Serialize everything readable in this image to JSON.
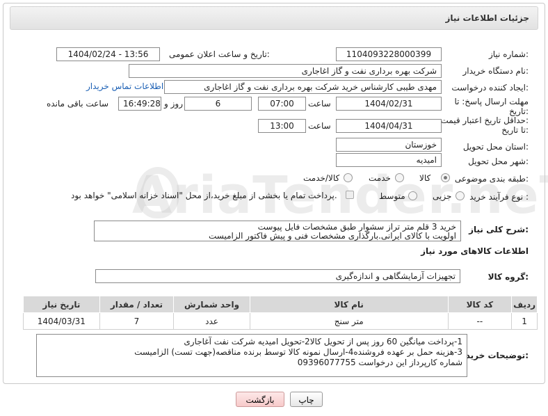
{
  "header": {
    "title": "جزئیات اطلاعات نیاز"
  },
  "form": {
    "need_number_label": "شماره نیاز:",
    "need_number": "1104093228000399",
    "announce_label": "تاریخ و ساعت اعلان عمومی:",
    "announce_value": "1404/02/24 - 13:56",
    "buyer_org_label": "نام دستگاه خریدار:",
    "buyer_org": "شرکت بهره برداری نفت و گاز اغاجاری",
    "creator_label": "ایجاد کننده درخواست:",
    "creator": "مهدی طیبی کارشناس خرید شرکت بهره برداری نفت و گاز اغاجاری",
    "contact_link": "اطلاعات تماس خریدار",
    "deadline_label": "مهلت ارسال پاسخ: تا",
    "deadline_label2": "تاریخ:",
    "deadline_date": "1404/02/31",
    "time_word": "ساعت",
    "deadline_time": "07:00",
    "days": "6",
    "days_word": "روز و",
    "remaining": "16:49:28",
    "remaining_word": "ساعت باقی مانده",
    "validity_label": "حداقل تاریخ اعتبار قیمت:",
    "validity_label2": "تا تاریخ:",
    "validity_date": "1404/04/31",
    "validity_time": "13:00",
    "province_label": "استان محل تحویل:",
    "province": "خوزستان",
    "city_label": "شهر محل تحویل:",
    "city": "امیدیه",
    "category_label": "طبقه بندی موضوعی:",
    "category_options": [
      "کالا",
      "خدمت",
      "کالا/خدمت"
    ],
    "process_label": "نوع فرآیند خرید :",
    "process_options": [
      "جزیی",
      "متوسط"
    ],
    "payment_note": "پرداخت تمام یا بخشی از مبلغ خرید،از محل \"اسناد خزانه اسلامی\" خواهد بود."
  },
  "description": {
    "label": "شرح کلی نیاز:",
    "lines": [
      "خرید 3  قلم متر تراز سشوار طبق مشخصات فایل پیوست",
      "اولویت با کالای ایرانی.بارگذاری مشخصات فنی و پیش فاکتور الزامیست"
    ]
  },
  "goods": {
    "section_title": "اطلاعات کالاهای مورد نیاز",
    "group_label": "گروه کالا:",
    "group_value": "تجهیزات آزمایشگاهی و اندازه‌گیری",
    "columns": [
      "ردیف",
      "کد کالا",
      "نام کالا",
      "واحد شمارش",
      "تعداد / مقدار",
      "تاریخ نیاز"
    ],
    "rows": [
      {
        "row": "1",
        "code": "--",
        "name": "متر سنج",
        "unit": "عدد",
        "qty": "7",
        "date": "1404/03/31"
      }
    ]
  },
  "buyer_notes": {
    "label": "توضیحات خریدار:",
    "lines": [
      "1-پرداخت میانگین 60 روز پس از تحویل کالا2-تحویل امیدیه شرکت نفت آغاجاری",
      "3-هزینه حمل بر عهده فروشنده4-ارسال نمونه کالا توسط برنده مناقصه(جهت تست) الزامیست",
      "شماره کارپرداز این درخواست 09396077755"
    ]
  },
  "buttons": {
    "print": "چاپ",
    "back": "بازگشت"
  },
  "watermark": "AriaTender.neT"
}
